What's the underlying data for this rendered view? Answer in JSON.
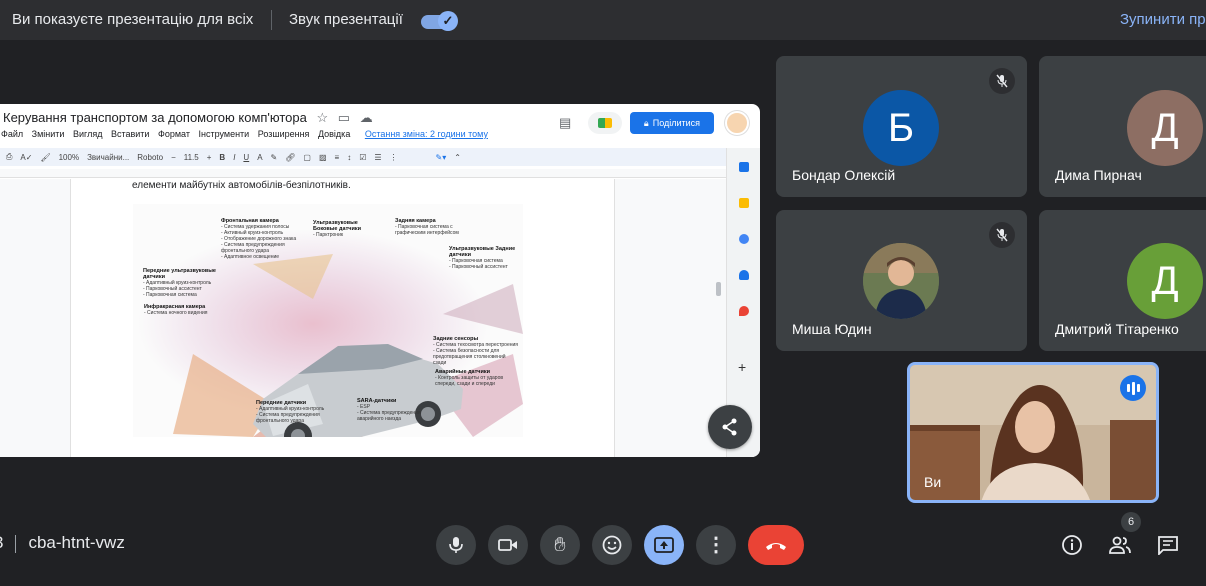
{
  "banner": {
    "presenting_text": "Ви показуєте презентацію для всіх",
    "audio_label": "Звук презентації",
    "audio_enabled": true,
    "stop_label": "Зупинити пр"
  },
  "doc": {
    "title": "Керування транспортом за допомогою комп'ютора",
    "menu": [
      "Файл",
      "Змінити",
      "Вигляд",
      "Вставити",
      "Формат",
      "Інструменти",
      "Розширення",
      "Довідка"
    ],
    "last_edit": "Остання зміна: 2 години тому",
    "share_label": "Поділитися",
    "toolbar": {
      "zoom": "100%",
      "style": "Звичайни...",
      "font": "Roboto",
      "size": "11.5",
      "bold": "B",
      "italic": "I",
      "underline": "U",
      "color": "A",
      "minus": "−",
      "plus": "+"
    },
    "body_text": "елементи майбутніх автомобілів-безпілотників.",
    "diagram_labels": {
      "front_camera": {
        "title": "Фронтальная камера",
        "text": "- Система удержания полосы\n- Активный круиз-контроль\n- Отображение дорожного знака\n- Система предупреждения фронтального удара\n- Адаптивное освещение"
      },
      "side_sensors": {
        "title": "Ультразвуковые Боковые датчики",
        "text": "- Парктроник"
      },
      "rear_camera": {
        "title": "Задняя камера",
        "text": "- Парковочная система с графическим интерфейсом"
      },
      "rear_ultra": {
        "title": "Ультразвуковые Задние датчики",
        "text": "- Парковочная система\n- Парковочный ассистент"
      },
      "front_ultra": {
        "title": "Передние ультразвуковые датчики",
        "text": "- Адаптивный круиз-контроль\n- Парковочный ассистент\n- Парковочная система"
      },
      "infrared": {
        "title": "Инфракрасная камера",
        "text": "- Система ночного видения"
      },
      "rear_sensors": {
        "title": "Задние сенсоры",
        "text": "- Система техосмотра перестроения\n- Система безопасности для предотвращения столкновений сзади"
      },
      "crash_sensors": {
        "title": "Аварийные датчики",
        "text": "- Контроль защиты от ударов спереди, сзади и спереди"
      },
      "front_sensors": {
        "title": "Передние датчики",
        "text": "- Адаптивный круиз-контроль\n- Система предупреждения фронтального удара"
      },
      "sara": {
        "title": "SARA-датчики",
        "text": "- ESP\n- Система предупреждения аварийного наезда"
      }
    }
  },
  "participants": [
    {
      "initial": "Б",
      "name": "Бондар Олексій",
      "color": "#0b57a6",
      "muted": true
    },
    {
      "initial": "Д",
      "name": "Дима Пирнач",
      "color": "#8d6e63",
      "muted": false
    },
    {
      "initial": "",
      "name": "Миша Юдин",
      "color": "#5d6b4f",
      "muted": true
    },
    {
      "initial": "Д",
      "name": "Дмитрий Тітаренко",
      "color": "#689f38",
      "muted": false
    }
  ],
  "self": {
    "name": "Ви"
  },
  "bottom": {
    "meeting_code": "cba-htnt-vwz",
    "time_fragment": "3",
    "people_count": "6"
  },
  "colors": {
    "accent": "#8ab4f8",
    "end_call": "#ea4335",
    "background": "#202124",
    "tile": "#3c4043"
  }
}
